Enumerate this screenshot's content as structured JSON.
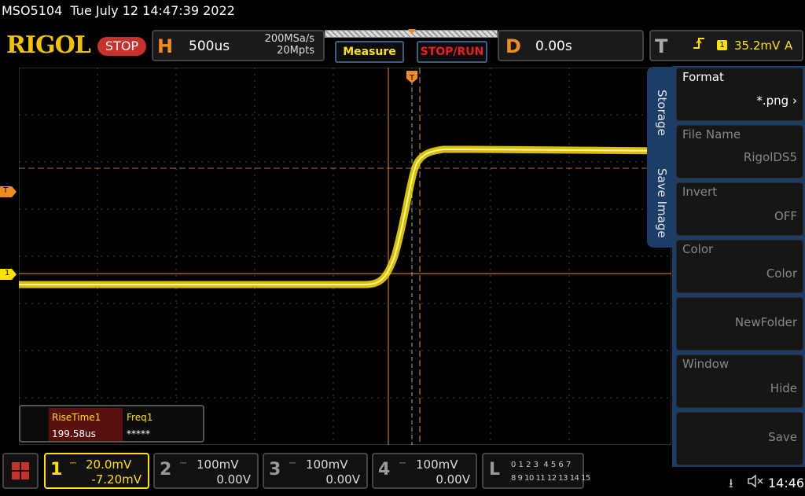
{
  "status": {
    "model": "MSO5104",
    "datetime": "Tue July 12 14:47:39 2022"
  },
  "header": {
    "logo": "RIGOL",
    "run_state": "STOP",
    "horizontal": {
      "letter": "H",
      "timebase": "500us",
      "sample_rate": "200MSa/s",
      "memory_depth": "20Mpts"
    },
    "measure_label": "Measure",
    "stoprun_label": "STOP/RUN",
    "delay": {
      "letter": "D",
      "value": "0.00s"
    },
    "trigger": {
      "letter": "T",
      "slope_icon": "rising-edge-icon",
      "channel": "1",
      "level": "35.2mV",
      "mode": "A"
    }
  },
  "screen_markers": {
    "trigger_marker": "T",
    "trigger_level_marker": "T",
    "channel1_marker": "1"
  },
  "side_menu": {
    "tabs": [
      "Storage",
      "Save Image"
    ],
    "items": [
      {
        "title": "Format",
        "value": "*.png"
      },
      {
        "title": "File Name",
        "value": "RigolDS5"
      },
      {
        "title": "Invert",
        "value": "OFF"
      },
      {
        "title": "Color",
        "value": "Color"
      },
      {
        "title": "",
        "value": "NewFolder"
      },
      {
        "title": "Window",
        "value": "Hide"
      },
      {
        "title": "",
        "value": "Save"
      }
    ]
  },
  "measurements": [
    {
      "label": "RiseTime1",
      "value": "199.58us"
    },
    {
      "label": "Freq1",
      "value": "*****"
    }
  ],
  "channels": [
    {
      "num": "1",
      "scale": "20.0mV",
      "offset": "-7.20mV",
      "active": true,
      "color": "#ffe000"
    },
    {
      "num": "2",
      "scale": "100mV",
      "offset": "0.00V",
      "active": false
    },
    {
      "num": "3",
      "scale": "100mV",
      "offset": "0.00V",
      "active": false
    },
    {
      "num": "4",
      "scale": "100mV",
      "offset": "0.00V",
      "active": false
    }
  ],
  "logic": {
    "letter": "L",
    "row1": "0 1 2 3  4 5 6 7",
    "row2": "8 9 10 11 12 13 14 15"
  },
  "system": {
    "time": "14:46",
    "usb_icon": "usb-icon",
    "speaker_icon": "speaker-muted-icon"
  },
  "colors": {
    "trace": "#ffe000",
    "accent": "#f08c1e",
    "menu_blue": "#1b3d66",
    "stop_red": "#c8322e"
  }
}
